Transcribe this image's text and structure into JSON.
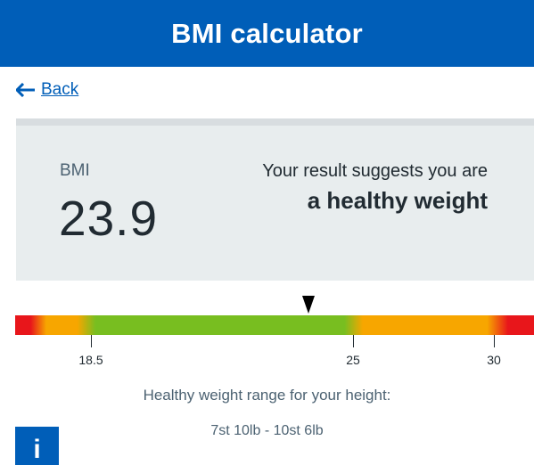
{
  "header": {
    "title": "BMI calculator"
  },
  "nav": {
    "back_label": "Back"
  },
  "result": {
    "bmi_label": "BMI",
    "bmi_value": "23.9",
    "suggestion": "Your result suggests you are",
    "category": "a healthy weight"
  },
  "scale": {
    "current_bmi": 23.9,
    "ticks": [
      {
        "label": "18.5",
        "value": 18.5
      },
      {
        "label": "25",
        "value": 25
      },
      {
        "label": "30",
        "value": 30
      }
    ],
    "zones": [
      "underweight",
      "healthy",
      "overweight",
      "obese"
    ],
    "colors": {
      "red": "#e8161b",
      "amber": "#f7a600",
      "green": "#78be20"
    }
  },
  "healthy_range": {
    "title": "Healthy weight range for your height:",
    "value": "7st 10lb - 10st 6lb"
  },
  "info": {
    "icon_glyph": "i",
    "icon": "info-icon"
  },
  "colors": {
    "brand_blue": "#005eb8",
    "panel_grey": "#e8edee",
    "text_dark": "#212b32",
    "text_secondary": "#4c6272"
  }
}
